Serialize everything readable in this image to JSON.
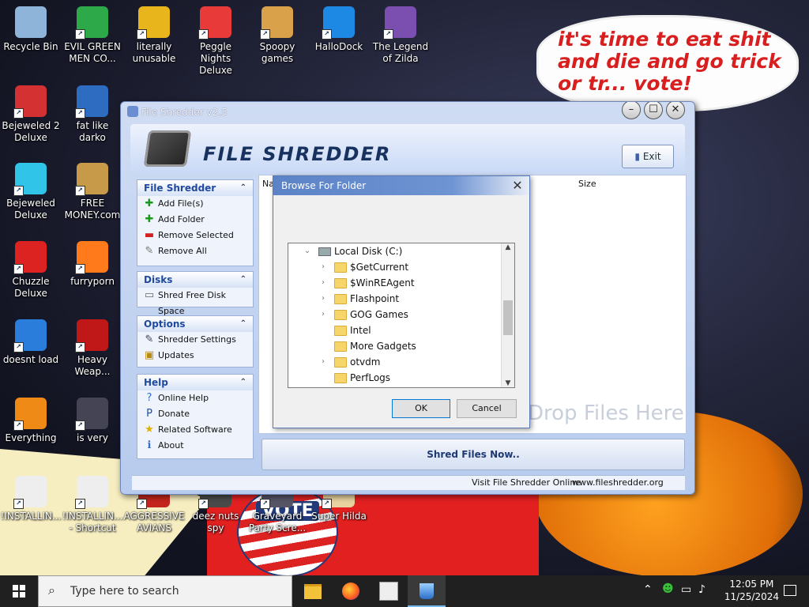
{
  "desktop": {
    "icons": [
      {
        "label": "Recycle Bin",
        "icon": "recycle-bin-icon"
      },
      {
        "label": "EVIL GREEN MEN CO...",
        "icon": "people-icon"
      },
      {
        "label": "literally unusable",
        "icon": "chrome-icon"
      },
      {
        "label": "Peggle Nights Deluxe",
        "icon": "peggle-icon"
      },
      {
        "label": "Spoopy games",
        "icon": "folder-icon"
      },
      {
        "label": "HalloDock",
        "icon": "windows-icon"
      },
      {
        "label": "The Legend of Zilda",
        "icon": "zilda-icon"
      },
      {
        "label": "Bejeweled 2 Deluxe",
        "icon": "bejeweled2-icon"
      },
      {
        "label": "fat like darko",
        "icon": "mpl-icon"
      },
      {
        "label": "Bejeweled Deluxe",
        "icon": "gem-icon"
      },
      {
        "label": "FREE MONEY.com",
        "icon": "money-bag-icon"
      },
      {
        "label": "Chuzzle Deluxe",
        "icon": "chuzzle-icon"
      },
      {
        "label": "furryporn",
        "icon": "firefox-icon"
      },
      {
        "label": "doesnt load",
        "icon": "thunderbird-icon"
      },
      {
        "label": "Heavy Weap...",
        "icon": "radiation-icon"
      },
      {
        "label": "Everything",
        "icon": "search-ring-icon"
      },
      {
        "label": "is very",
        "icon": "mpl-shield-icon"
      },
      {
        "label": "!INSTALLIN...",
        "icon": "document-icon"
      },
      {
        "label": "!INSTALLIN... - Shortcut",
        "icon": "document-shortcut-icon"
      },
      {
        "label": "AGGRESSIVE AVIANS",
        "icon": "angry-bird-icon"
      },
      {
        "label": "deez nuts spy",
        "icon": "spy-icon"
      },
      {
        "label": "Graveyard Party Scre...",
        "icon": "graveyard-icon"
      },
      {
        "label": "Super Hilda",
        "icon": "hilda-icon"
      }
    ],
    "speech_bubble": "it's time to eat shit and die and go trick or tr... vote!",
    "vote_badge": "VOTE"
  },
  "file_shredder": {
    "title": "File Shredder v2.5",
    "logo_text": "FILE SHREDDER",
    "exit_label": "Exit",
    "panels": {
      "file_shredder": {
        "title": "File Shredder",
        "items": [
          "Add File(s)",
          "Add Folder",
          "Remove Selected",
          "Remove All"
        ]
      },
      "disks": {
        "title": "Disks",
        "items": [
          "Shred Free Disk Space"
        ]
      },
      "options": {
        "title": "Options",
        "items": [
          "Shredder Settings",
          "Updates"
        ]
      },
      "help": {
        "title": "Help",
        "items": [
          "Online Help",
          "Donate",
          "Related Software",
          "About"
        ]
      }
    },
    "columns": {
      "name": "Na",
      "size": "Size"
    },
    "drop_hint": "Drop Files Here",
    "shred_button": "Shred Files Now..",
    "status_link1": "Visit File Shredder Online",
    "status_link2": "www.fileshredder.org"
  },
  "browse_dialog": {
    "title": "Browse For Folder",
    "root": "Local Disk (C:)",
    "folders": [
      "$GetCurrent",
      "$WinREAgent",
      "Flashpoint",
      "GOG Games",
      "Intel",
      "More Gadgets",
      "otvdm",
      "PerfLogs"
    ],
    "expandable": [
      true,
      true,
      true,
      true,
      false,
      false,
      true,
      false
    ],
    "ok_label": "OK",
    "cancel_label": "Cancel"
  },
  "taskbar": {
    "search_placeholder": "Type here to search",
    "time": "12:05 PM",
    "date": "11/25/2024"
  }
}
